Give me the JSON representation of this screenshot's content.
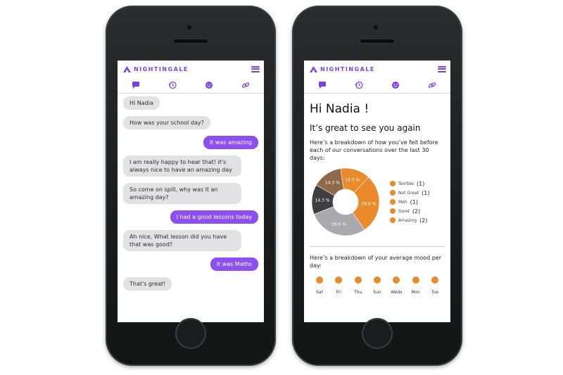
{
  "app": {
    "name": "NIGHTINGALE",
    "accent": "#7b3fe4",
    "bubble_out": "#8d4ff0"
  },
  "nav_icons": [
    "chat-icon",
    "history-icon",
    "mood-face-icon",
    "link-icon"
  ],
  "chat": {
    "messages": [
      {
        "from": "bot",
        "text": "Hi Nadia"
      },
      {
        "from": "bot",
        "text": "How was your school day?"
      },
      {
        "from": "user",
        "text": "it was amazing"
      },
      {
        "from": "bot",
        "text": "I am really happy to hear that! it's always nice to have an amazing day"
      },
      {
        "from": "bot",
        "text": "So come on spill, why was it an amazing day?"
      },
      {
        "from": "user",
        "text": "I had a good lessons today"
      },
      {
        "from": "bot",
        "text": "Ah nice, What lesson did you have that was good?"
      },
      {
        "from": "user",
        "text": "it was Maths"
      },
      {
        "from": "bot",
        "text": "That's great!"
      }
    ]
  },
  "dashboard": {
    "greeting": "Hi Nadia !",
    "subtitle": "It’s great to see you again",
    "breakdown_intro": "Here’s a breakdown of how you’ve felt before each of our conversations over the last 30 days:",
    "legend": [
      {
        "label": "Terrible",
        "count": "(1)"
      },
      {
        "label": "Not Great",
        "count": "(1)"
      },
      {
        "label": "Meh",
        "count": "(1)"
      },
      {
        "label": "Good",
        "count": "(2)"
      },
      {
        "label": "Amazing",
        "count": "(2)"
      }
    ],
    "mood_intro": "Here’s a breakdown of your average mood per day:",
    "days": [
      "Sat",
      "Fri",
      "Thu",
      "Sun",
      "Weds",
      "Mon",
      "Tue"
    ]
  },
  "chart_data": {
    "type": "pie",
    "slices": [
      {
        "label": "14.3 %",
        "value": 14.3,
        "color": "#ea8a2b"
      },
      {
        "label": "28.6 %",
        "value": 28.6,
        "color": "#ea8a2b"
      },
      {
        "label": "28.6 %",
        "value": 28.6,
        "color": "#a9a9ae"
      },
      {
        "label": "14.3 %",
        "value": 14.3,
        "color": "#3f3f42"
      },
      {
        "label": "14.3 %",
        "value": 14.3,
        "color": "#8e6a4a"
      }
    ],
    "donut": true
  }
}
